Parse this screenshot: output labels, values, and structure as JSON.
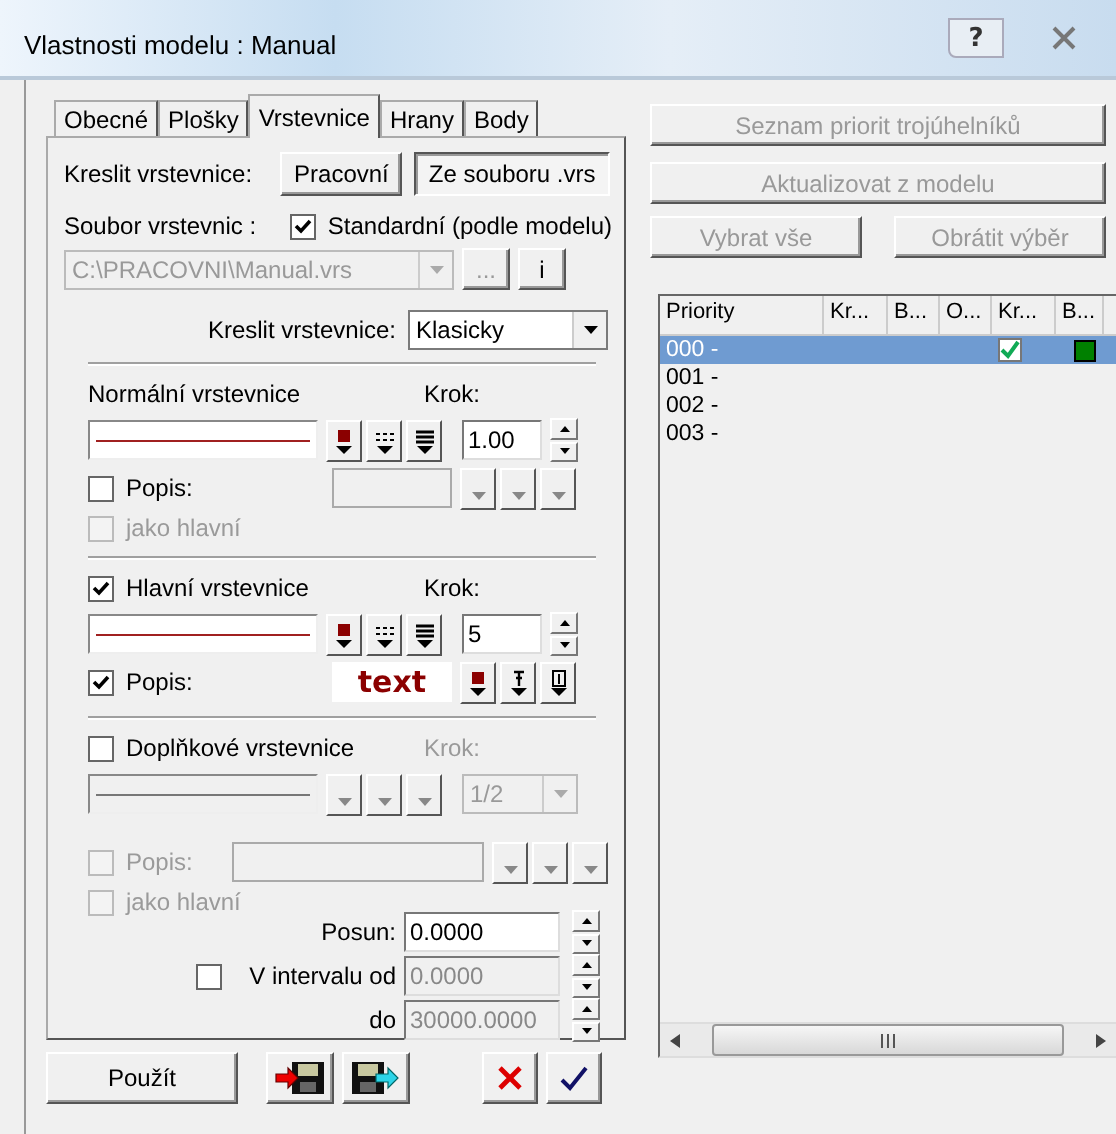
{
  "window": {
    "title": "Vlastnosti modelu : Manual",
    "help": "?"
  },
  "tabs": [
    {
      "label": "Obecné",
      "selected": false
    },
    {
      "label": "Plošky",
      "selected": false
    },
    {
      "label": "Vrstevnice",
      "selected": true
    },
    {
      "label": "Hrany",
      "selected": false
    },
    {
      "label": "Body",
      "selected": false
    }
  ],
  "draw_source": {
    "label": "Kreslit vrstevnice:",
    "options": [
      {
        "label": "Pracovní",
        "selected": false
      },
      {
        "label": "Ze souboru .vrs",
        "selected": true
      }
    ]
  },
  "contour_file": {
    "label": "Soubor vrstevnic :",
    "standard": {
      "label": "Standardní (podle modelu)",
      "checked": true
    },
    "path": "C:\\PRACOVNI\\Manual.vrs",
    "browse": "...",
    "info": "i"
  },
  "draw_style": {
    "label": "Kreslit vrstevnice:",
    "value": "Klasicky"
  },
  "normal": {
    "title": "Normální vrstevnice",
    "step_label": "Krok:",
    "step": "1.00",
    "caption": {
      "label": "Popis:",
      "checked": false
    },
    "as_main": {
      "label": "jako hlavní",
      "checked": false
    }
  },
  "main": {
    "title": "Hlavní vrstevnice",
    "checked": true,
    "step_label": "Krok:",
    "step": "5",
    "caption": {
      "label": "Popis:",
      "checked": true
    },
    "sample": "text"
  },
  "supplementary": {
    "title": "Doplňkové vrstevnice",
    "checked": false,
    "step_label": "Krok:",
    "step": "1/2",
    "caption": {
      "label": "Popis:",
      "checked": false
    },
    "as_main": {
      "label": "jako hlavní",
      "checked": false
    }
  },
  "offset": {
    "label": "Posun:",
    "value": "0.0000"
  },
  "interval": {
    "checked": false,
    "from_label": "V intervalu od",
    "from": "0.0000",
    "to_label": "do",
    "to": "30000.0000"
  },
  "apply_button": "Použít",
  "right_buttons": [
    {
      "label": "Seznam priorit trojúhelníků",
      "disabled": true
    },
    {
      "label": "Aktualizovat z modelu",
      "disabled": true
    },
    {
      "label": "Vybrat vše",
      "disabled": true
    },
    {
      "label": "Obrátit výběr",
      "disabled": true
    }
  ],
  "priority_table": {
    "columns": [
      "Priority",
      "Kr...",
      "B...",
      "O...",
      "Kr...",
      "B..."
    ],
    "rows": [
      {
        "name": "000 -",
        "selected": true,
        "checked": true,
        "color": "#008000"
      },
      {
        "name": "001 -",
        "selected": false
      },
      {
        "name": "002 -",
        "selected": false
      },
      {
        "name": "003 -",
        "selected": false
      }
    ]
  }
}
